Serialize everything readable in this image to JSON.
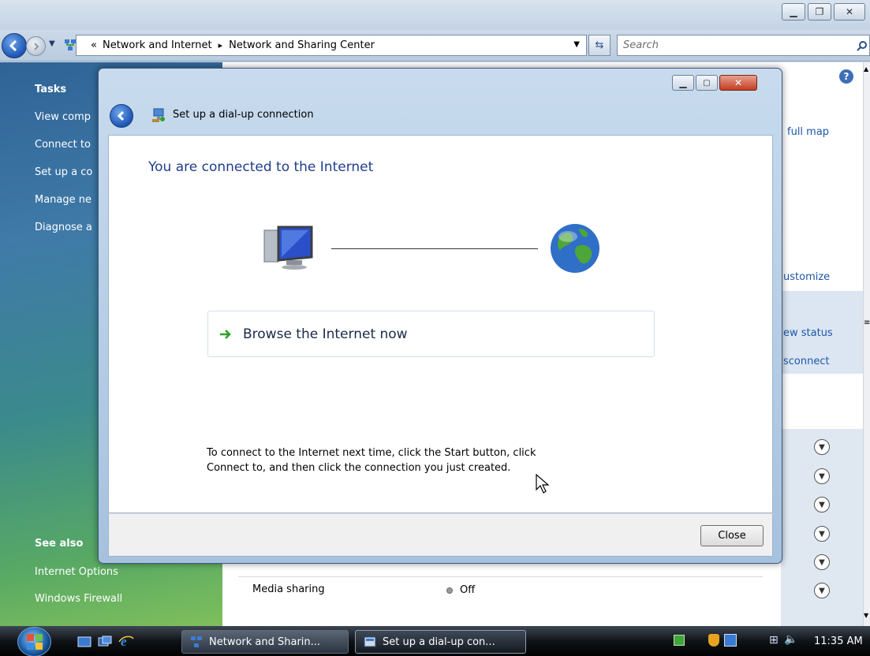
{
  "window": {
    "address": {
      "prefix": "«",
      "crumbs": [
        "Network and Internet",
        "Network and Sharing Center"
      ],
      "separator": "▸"
    },
    "search_placeholder": "Search"
  },
  "sidebar": {
    "tasks_header": "Tasks",
    "tasks": [
      "View comp",
      "Connect to",
      "Set up a co",
      "Manage ne",
      "Diagnose a"
    ],
    "see_also_header": "See also",
    "see_also": [
      "Internet Options",
      "Windows Firewall"
    ]
  },
  "content_peek": {
    "full_map": "full map",
    "customize": "ustomize",
    "view_status": "ew status",
    "disconnect": "sconnect",
    "media_sharing": "Media sharing",
    "media_sharing_value": "Off"
  },
  "dialog": {
    "title": "Set up a dial-up connection",
    "heading": "You are connected to the Internet",
    "browse_label": "Browse the Internet now",
    "instruction": "To connect to the Internet next time, click the Start button, click\nConnect to, and then click the connection you just created.",
    "close_label": "Close"
  },
  "taskbar": {
    "items": [
      "Network and Sharin...",
      "Set up a dial-up con..."
    ],
    "clock": "11:35 AM"
  },
  "colors": {
    "link": "#1c57a8",
    "heading": "#1e3d8c",
    "accent_arrow": "#2fa12a"
  }
}
